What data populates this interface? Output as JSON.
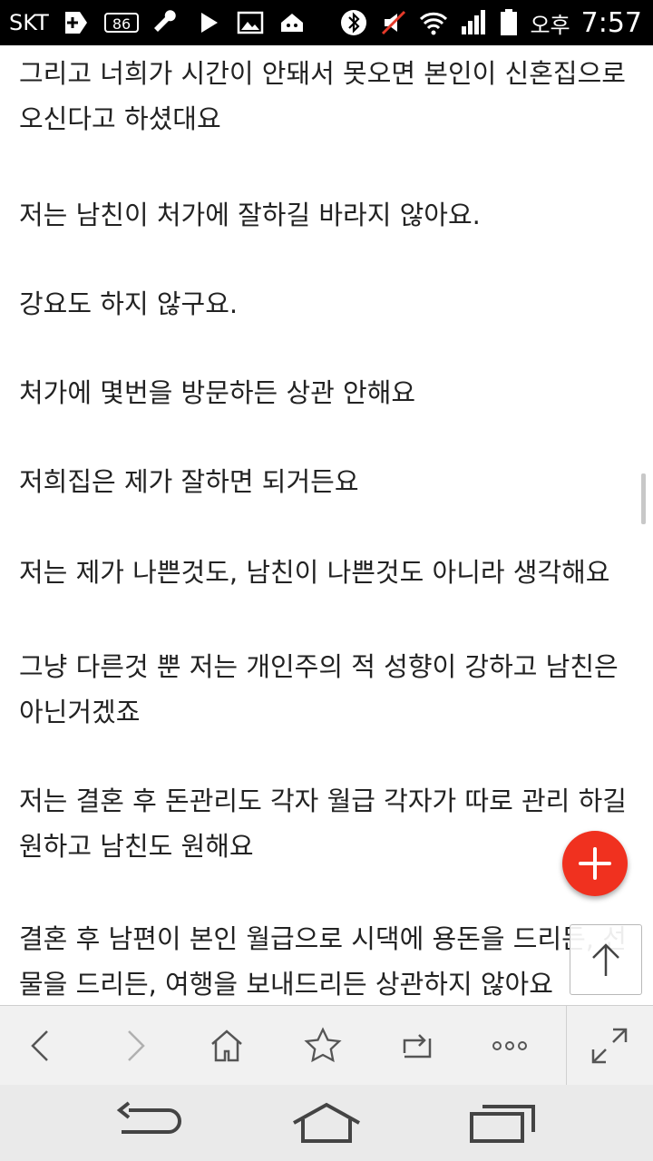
{
  "status_bar": {
    "carrier": "SKT",
    "badge_number": "86",
    "ampm": "오후",
    "time": "7:57"
  },
  "content": {
    "paragraphs": [
      {
        "lines": [
          "그리고 너희가 시간이 안돼서 못오면 본인이 신혼집으로",
          "오신다고 하셨대요"
        ]
      },
      {
        "lines": [
          "저는 남친이 처가에 잘하길 바라지 않아요."
        ]
      },
      {
        "lines": [
          "강요도 하지 않구요."
        ]
      },
      {
        "lines": [
          "처가에 몇번을 방문하든 상관 안해요"
        ]
      },
      {
        "lines": [
          "저희집은 제가 잘하면 되거든요"
        ]
      },
      {
        "lines": [
          "저는 제가 나쁜것도, 남친이 나쁜것도 아니라 생각해요"
        ]
      },
      {
        "lines": [
          "그냥 다른것 뿐 저는 개인주의 적 성향이 강하고 남친은",
          "아닌거겠죠"
        ]
      },
      {
        "lines": [
          "저는 결혼 후 돈관리도 각자 월급 각자가 따로 관리 하길",
          "원하고 남친도 원해요"
        ]
      },
      {
        "lines": [
          "결혼 후 남편이 본인 월급으로 시댁에 용돈을 드리든, 선",
          "물을 드리든, 여행을 보내드리든 상관하지 않아요"
        ]
      }
    ]
  },
  "colors": {
    "fab": "#f0311f",
    "status_bar_bg": "#000000",
    "toolbar_bg": "#f1f1f1",
    "navbar_bg": "#eaeaea",
    "text": "#222222"
  }
}
